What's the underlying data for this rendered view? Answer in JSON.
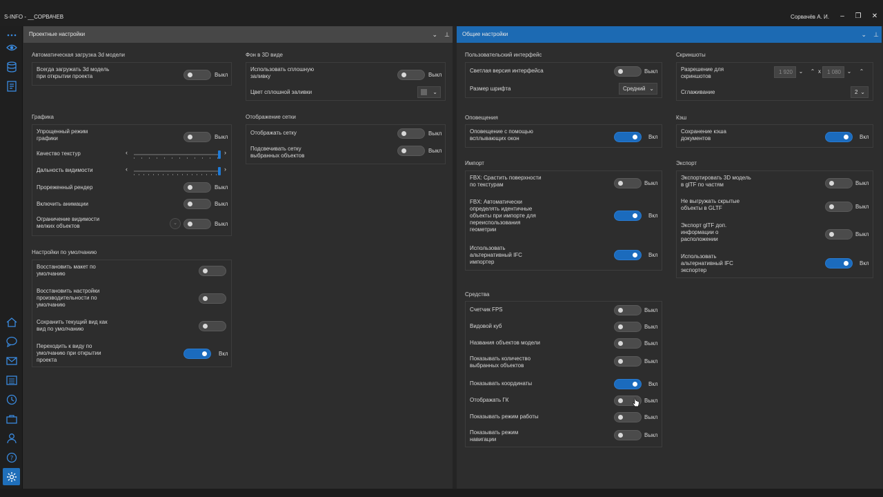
{
  "window": {
    "title": "S-INFO - __СОРВАЧЕВ",
    "user": "Сорвачёв А. И.",
    "controls": {
      "minimize": "–",
      "restore": "❐",
      "close": "✕"
    }
  },
  "rail": {
    "items": [
      "more-icon",
      "eye-icon",
      "database-icon",
      "document-icon",
      "home-icon",
      "chat-icon",
      "mail-icon",
      "list-icon",
      "history-icon",
      "briefcase-icon",
      "user-icon",
      "help-icon",
      "settings-icon"
    ],
    "active": "settings-icon",
    "accent": "#1f6fba"
  },
  "left_panel": {
    "title": "Проектные настройки",
    "header_color": "#474747",
    "sections": {
      "autoload": {
        "title": "Автоматическая загрузка 3d модели",
        "rows": [
          {
            "label": "Всегда загружать 3d модель\nпри открытии проекта",
            "on": false,
            "state": "Выкл"
          }
        ]
      },
      "background": {
        "title": "Фон в 3D виде",
        "solid_fill": {
          "label": "Использовать сплошную\nзаливку",
          "on": false,
          "state": "Выкл"
        },
        "fill_color": {
          "label": "Цвет сплошной заливки",
          "chevron": "⌄"
        }
      },
      "graphics": {
        "title": "Графика",
        "simplified": {
          "label": "Упрощенный режим\nграфики",
          "on": false,
          "state": "Выкл"
        },
        "texture_quality": {
          "label": "Качество текстур",
          "value": 1.0
        },
        "view_distance": {
          "label": "Дальность видимости",
          "value": 1.0
        },
        "thinned_render": {
          "label": "Прореженный рендер",
          "on": false,
          "state": "Выкл"
        },
        "animations": {
          "label": "Включить анимации",
          "on": false,
          "state": "Выкл"
        },
        "small_objects": {
          "label": "Ограничение видимости\nмелких объектов",
          "on": false,
          "state": "Выкл"
        }
      },
      "grid": {
        "title": "Отображение сетки",
        "rows": [
          {
            "label": "Отображать сетку",
            "on": false,
            "state": "Выкл"
          },
          {
            "label": "Подсвечивать сетку\nвыбранных объектов",
            "on": false,
            "state": "Выкл"
          }
        ]
      },
      "defaults": {
        "title": "Настройки по умолчанию",
        "rows": [
          {
            "label": "Восстановить макет по\nумолчанию",
            "on": false,
            "state": ""
          },
          {
            "label": "Восстановить настройки\nпроизводительности по\nумолчанию",
            "on": false,
            "state": ""
          },
          {
            "label": "Сохранить текущий вид как\nвид по умолчанию",
            "on": false,
            "state": ""
          },
          {
            "label": "Переходить к виду по\nумолчанию при открытии\nпроекта",
            "on": true,
            "state": "Вкл"
          }
        ]
      }
    }
  },
  "right_panel": {
    "title": "Общие настройки",
    "header_color": "#1c6ab3",
    "sections": {
      "ui": {
        "title": "Пользовательский интерфейс",
        "light": {
          "label": "Светлая версия интерфейса",
          "on": false,
          "state": "Выкл"
        },
        "font_size": {
          "label": "Размер шрифта",
          "value": "Средний"
        }
      },
      "screenshots": {
        "title": "Скриншоты",
        "resolution": {
          "label": "Разрешение для\nскриншотов",
          "width": "1 920",
          "height": "1 080",
          "x": "x"
        },
        "smoothing": {
          "label": "Сглаживание",
          "value": "2"
        }
      },
      "notifications": {
        "title": "Оповещения",
        "rows": [
          {
            "label": "Оповещение с помощью\nвсплывающих окон",
            "on": true,
            "state": "Вкл"
          }
        ]
      },
      "cache": {
        "title": "Кэш",
        "rows": [
          {
            "label": "Сохранение кэша\nдокументов",
            "on": true,
            "state": "Вкл"
          }
        ]
      },
      "import": {
        "title": "Импорт",
        "rows": [
          {
            "label": "FBX: Срастить поверхности\nпо текстурам",
            "on": false,
            "state": "Выкл"
          },
          {
            "label": "FBX: Автоматически\nопределять идентичные\nобъекты при импорте для\nпереиспользования\nгеометрии",
            "on": true,
            "state": "Вкл"
          },
          {
            "label": "Использовать\nальтернативный IFC\nимпортер",
            "on": true,
            "state": "Вкл"
          }
        ]
      },
      "export": {
        "title": "Экспорт",
        "rows": [
          {
            "label": "Экспортировать 3D модель\nв glTF по частям",
            "on": false,
            "state": "Выкл"
          },
          {
            "label": "Не выгружать скрытые\nобъекты в GLTF",
            "on": false,
            "state": "Выкл"
          },
          {
            "label": "Экспорт glTF доп.\nинформации о\nрасположении",
            "on": false,
            "state": "Выкл"
          },
          {
            "label": "Использовать\nальтернативный IFC\nэкспортер",
            "on": true,
            "state": "Вкл"
          }
        ]
      },
      "tools": {
        "title": "Средства",
        "rows": [
          {
            "label": "Счетчик FPS",
            "on": false,
            "state": "Выкл"
          },
          {
            "label": "Видовой куб",
            "on": false,
            "state": "Выкл"
          },
          {
            "label": "Названия объектов модели",
            "on": false,
            "state": "Выкл"
          },
          {
            "label": "Показывать количество\nвыбранных объектов",
            "on": false,
            "state": "Выкл"
          },
          {
            "label": "Показывать координаты",
            "on": true,
            "state": "Вкл"
          },
          {
            "label": "Отображать ГК",
            "on": false,
            "state": "Выкл"
          },
          {
            "label": "Показывать режим работы",
            "on": false,
            "state": "Выкл"
          },
          {
            "label": "Показывать режим\nнавигации",
            "on": false,
            "state": "Выкл"
          }
        ]
      }
    }
  }
}
